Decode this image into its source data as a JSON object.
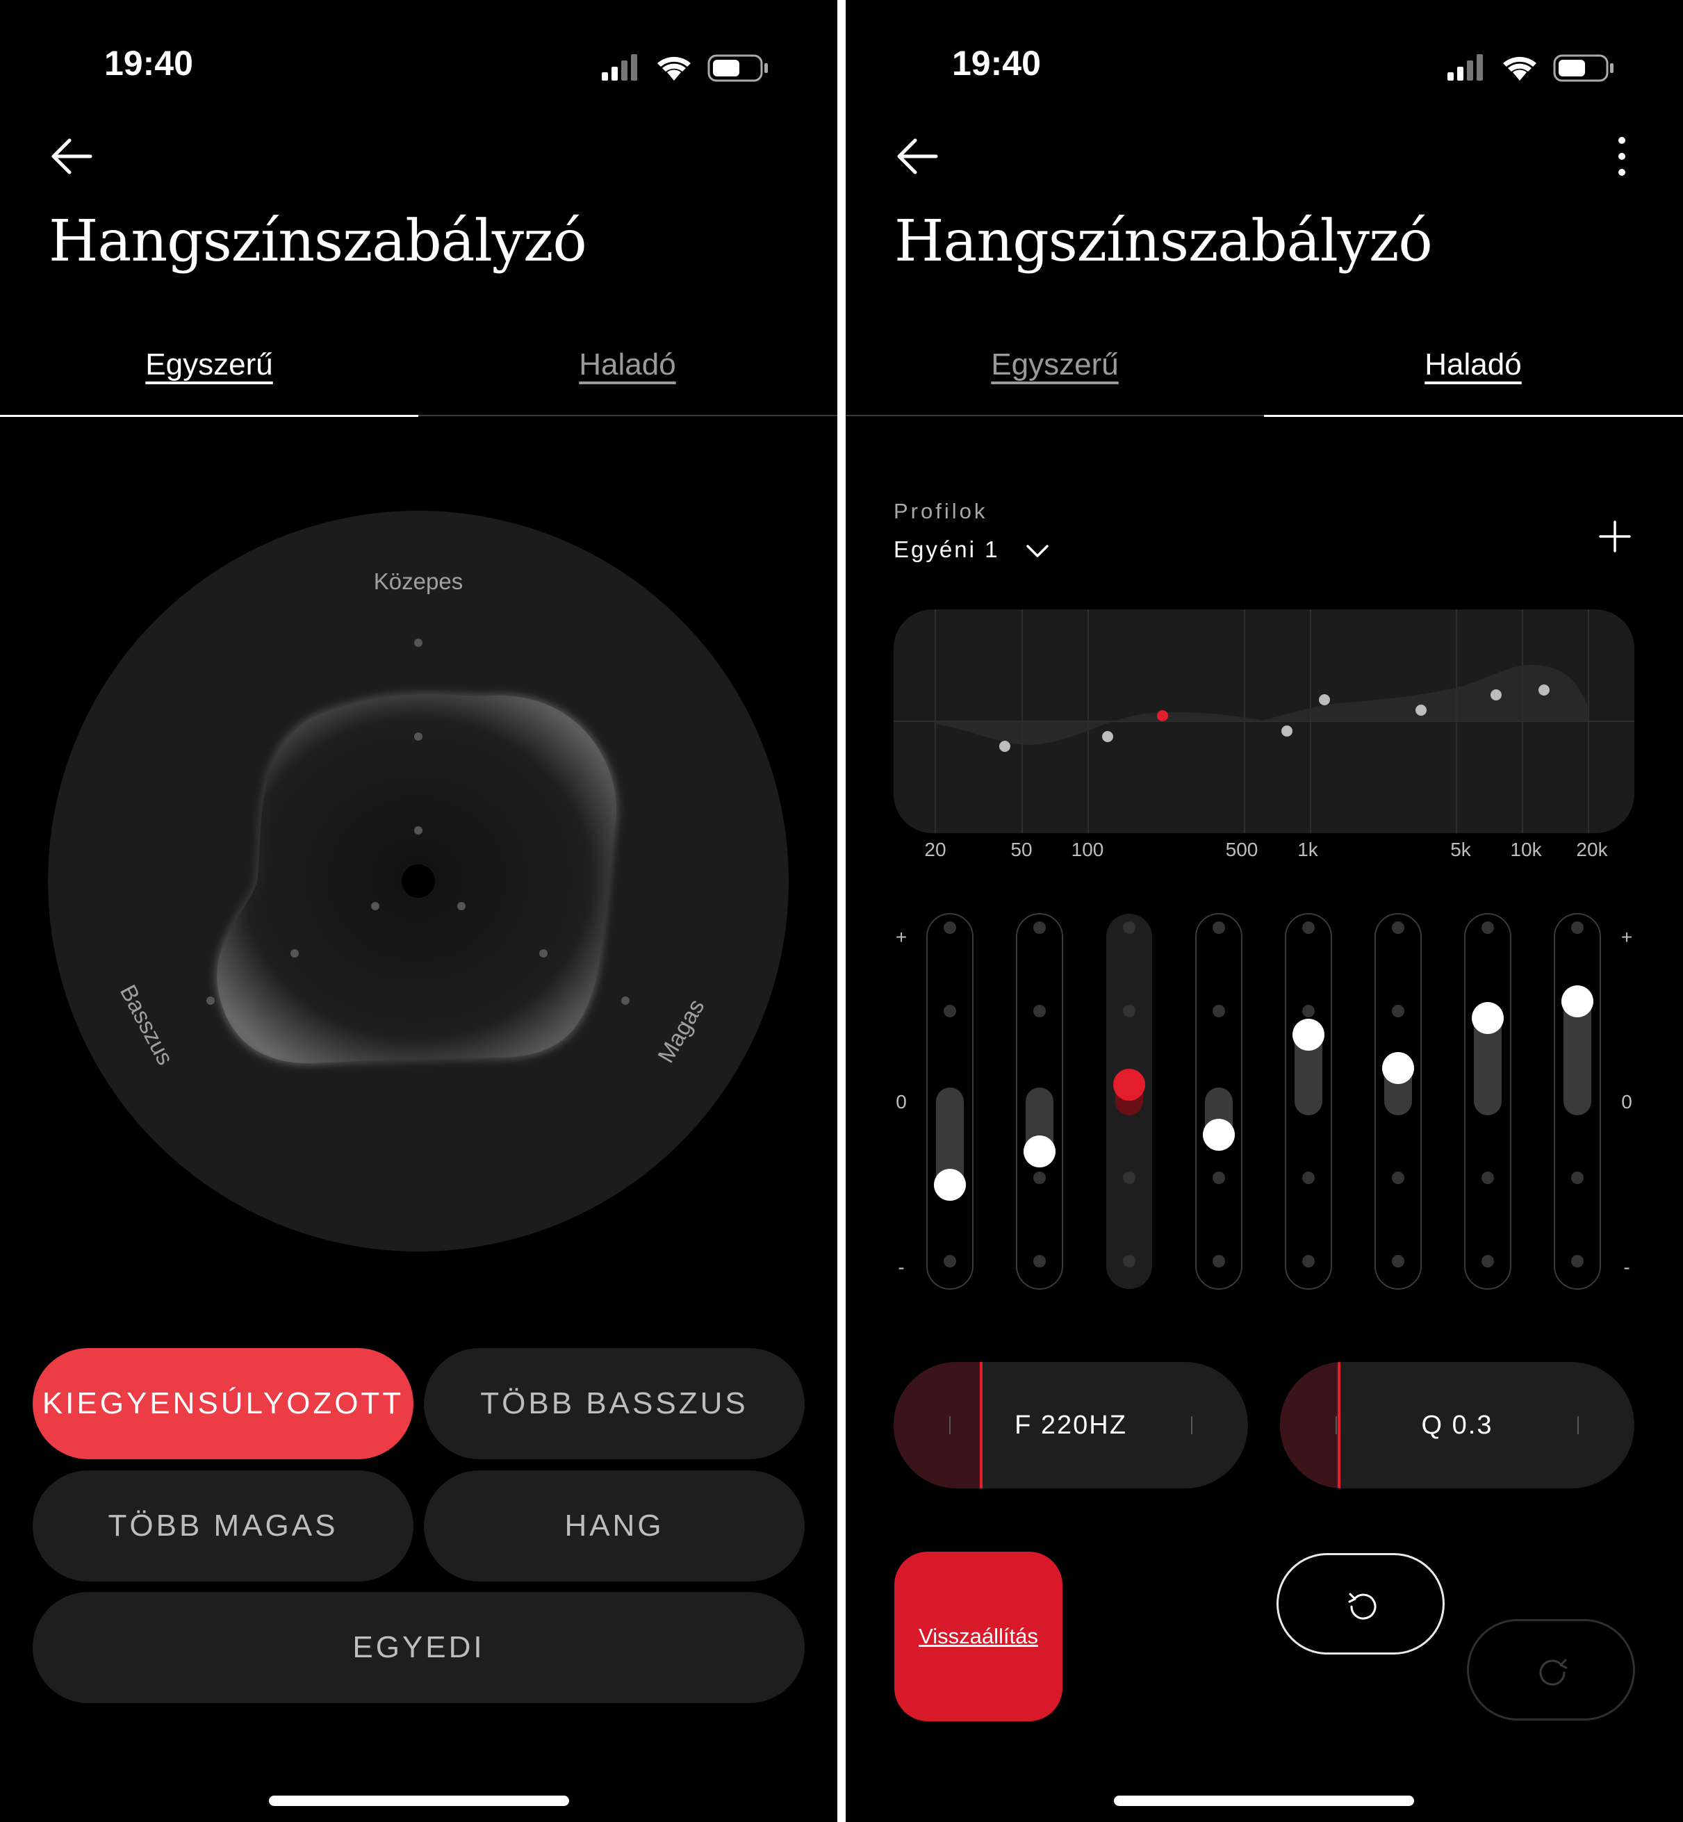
{
  "left": {
    "status": {
      "time": "19:40"
    },
    "title": "Hangszínszabályzó",
    "tabs": [
      {
        "label": "Egyszerű",
        "active": true
      },
      {
        "label": "Haladó",
        "active": false
      }
    ],
    "dial": {
      "top_label": "Közepes",
      "left_label": "Basszus",
      "right_label": "Magas"
    },
    "presets": [
      {
        "label": "KIEGYENSÚLYOZOTT",
        "active": true
      },
      {
        "label": "TÖBB BASSZUS",
        "active": false
      },
      {
        "label": "TÖBB MAGAS",
        "active": false
      },
      {
        "label": "HANG",
        "active": false
      },
      {
        "label": "EGYEDI",
        "active": false
      }
    ]
  },
  "right": {
    "status": {
      "time": "19:40"
    },
    "title": "Hangszínszabályzó",
    "tabs": [
      {
        "label": "Egyszerű",
        "active": false
      },
      {
        "label": "Haladó",
        "active": true
      }
    ],
    "profiles": {
      "label": "Profilok",
      "selected": "Egyéni 1"
    },
    "graph": {
      "freq_labels": [
        "20",
        "50",
        "100",
        "500",
        "1k",
        "5k",
        "10k",
        "20k"
      ]
    },
    "sliders": {
      "plus": "+",
      "zero": "0",
      "minus": "-",
      "levels": [
        -0.5,
        -0.3,
        0.1,
        -0.2,
        0.4,
        0.2,
        0.5,
        0.6
      ],
      "selected_index": 2
    },
    "params": {
      "freq": {
        "label": "F 220HZ",
        "fill": 0.25
      },
      "q": {
        "label": "Q 0.3",
        "fill": 0.17
      }
    },
    "reset_label": "Visszaállítás",
    "colors": {
      "accent": "#e31d2b",
      "preset_active": "#ec3d46",
      "surface": "#1e1e1e"
    }
  }
}
